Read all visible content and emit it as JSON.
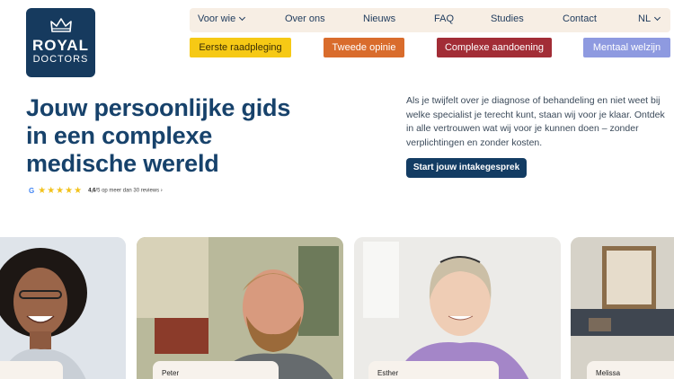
{
  "logo": {
    "line1": "ROYAL",
    "line2": "DOCTORS"
  },
  "nav": {
    "items": [
      "Voor wie",
      "Over ons",
      "Nieuws",
      "FAQ",
      "Studies",
      "Contact",
      "NL"
    ]
  },
  "categories": [
    "Eerste raadpleging",
    "Tweede opinie",
    "Complexe aandoening",
    "Mentaal welzijn"
  ],
  "hero": {
    "title_lines": [
      "Jouw persoonlijke gids",
      "in een complexe",
      "medische wereld"
    ],
    "intro": "Als je twijfelt over je diagnose of behandeling en niet weet bij welke specialist je terecht kunt, staan wij voor je klaar. Ontdek in alle vertrouwen wat wij voor je kunnen doen – zonder verplichtingen en zonder kosten.",
    "cta": "Start jouw intakegesprek"
  },
  "rating": {
    "google": "G",
    "stars": "★★★★★",
    "score": "4,6",
    "text": "/5 op meer dan 30 reviews ›",
    "value": 4.6
  },
  "cards": [
    {
      "name": ""
    },
    {
      "name": "Peter"
    },
    {
      "name": "Esther"
    },
    {
      "name": "Melissa"
    }
  ],
  "colors": {
    "navy": "#163a5e",
    "nav_bg": "#f7eee4",
    "yellow": "#f6c915",
    "orange": "#d96c2c",
    "red": "#a22d36",
    "purple": "#8e9ae0"
  }
}
